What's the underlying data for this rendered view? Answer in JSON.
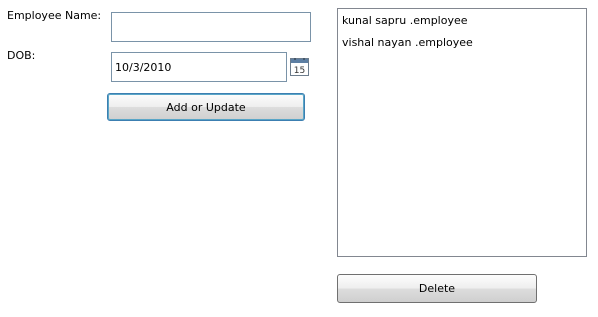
{
  "form": {
    "name_label": "Employee Name:",
    "name_value": "",
    "dob_label": "DOB:",
    "dob_value": "10/3/2010",
    "calendar_day": "15",
    "add_button_label": "Add or Update"
  },
  "employee_list": {
    "items": [
      {
        "label": "kunal sapru .employee"
      },
      {
        "label": "vishal nayan .employee"
      }
    ]
  },
  "delete_button_label": "Delete"
}
